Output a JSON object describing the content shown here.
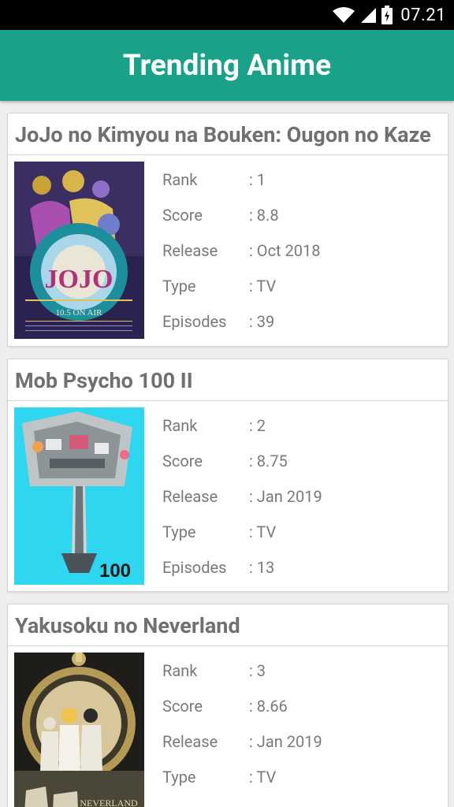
{
  "status_bar": {
    "time": "07.21"
  },
  "app_bar": {
    "title": "Trending Anime"
  },
  "anime": [
    {
      "title": "JoJo no Kimyou na Bouken: Ougon no Kaze",
      "poster_icon": "jojo-poster",
      "poster_text": "JOJO",
      "poster_subtext": "10.5 ON AIR",
      "rank": ": 1",
      "score": ": 8.8",
      "release": ": Oct 2018",
      "type": ": TV",
      "episodes": ": 39"
    },
    {
      "title": "Mob Psycho 100 II",
      "poster_icon": "mob-psycho-poster",
      "poster_text": "100",
      "rank": ": 2",
      "score": ": 8.75",
      "release": ": Jan 2019",
      "type": ": TV",
      "episodes": ": 13"
    },
    {
      "title": "Yakusoku no Neverland",
      "poster_icon": "neverland-poster",
      "poster_text": "NEVERLAND",
      "rank": ": 3",
      "score": ": 8.66",
      "release": ": Jan 2019",
      "type": ": TV",
      "episodes": ""
    }
  ],
  "labels": {
    "rank": "Rank",
    "score": "Score",
    "release": "Release",
    "type": "Type",
    "episodes": "Episodes"
  }
}
